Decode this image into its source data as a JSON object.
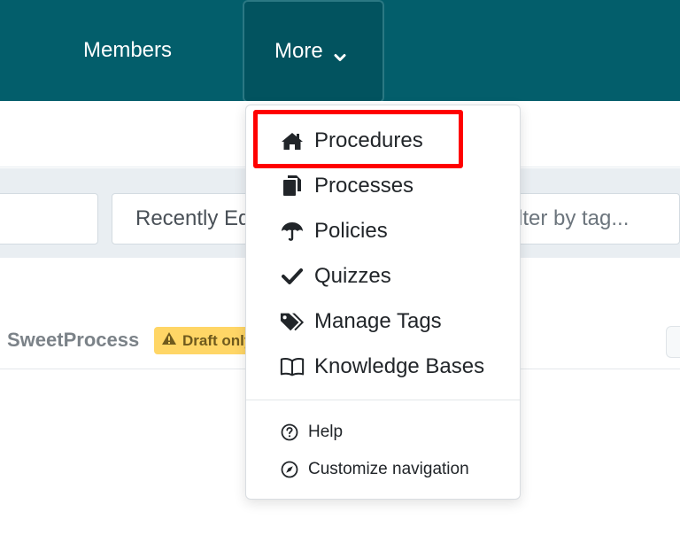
{
  "nav": {
    "members_label": "Members",
    "more_label": "More"
  },
  "filters": {
    "sort_value": "Recently Edited",
    "tag_placeholder": "Filter by tag..."
  },
  "org": {
    "name": "SweetProcess",
    "badge": "Draft only"
  },
  "menu": {
    "items": [
      {
        "label": "Procedures",
        "icon": "home-icon"
      },
      {
        "label": "Processes",
        "icon": "copy-icon"
      },
      {
        "label": "Policies",
        "icon": "umbrella-icon"
      },
      {
        "label": "Quizzes",
        "icon": "check-icon"
      },
      {
        "label": "Manage Tags",
        "icon": "tags-icon"
      },
      {
        "label": "Knowledge Bases",
        "icon": "book-open-icon"
      }
    ],
    "footer": [
      {
        "label": "Help",
        "icon": "question-circle-icon"
      },
      {
        "label": "Customize navigation",
        "icon": "compass-icon"
      }
    ]
  },
  "colors": {
    "nav_bg": "#035e6b",
    "highlight": "#ff0000",
    "badge_bg": "#ffd666"
  }
}
